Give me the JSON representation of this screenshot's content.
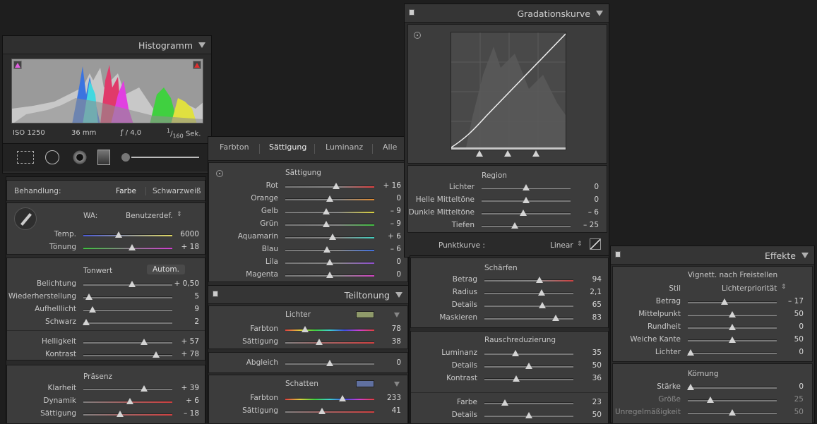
{
  "histogram": {
    "title": "Histogramm",
    "iso": "ISO 1250",
    "focal": "36 mm",
    "aperture": "ƒ / 4,0",
    "shutter_num": "1",
    "shutter_den": "160",
    "shutter_unit": "Sek."
  },
  "basic": {
    "treatment_label": "Behandlung:",
    "treatment_color": "Farbe",
    "treatment_bw": "Schwarzweiß",
    "wb_label": "WA:",
    "wb_value": "Benutzerdef.",
    "wb_sliders": [
      {
        "label": "Temp.",
        "value": "6000",
        "pos": 0.4,
        "grad": "linear-gradient(90deg,#4a5ad8,#e0d860)"
      },
      {
        "label": "Tönung",
        "value": "+ 18",
        "pos": 0.55,
        "grad": "linear-gradient(90deg,#40c040,#d040d0)"
      }
    ],
    "tone_title": "Tonwert",
    "auto_label": "Autom.",
    "tone_sliders": [
      {
        "label": "Belichtung",
        "value": "+ 0,50",
        "pos": 0.55
      },
      {
        "label": "Wiederherstellung",
        "value": "5",
        "pos": 0.06
      },
      {
        "label": "Aufhelllicht",
        "value": "9",
        "pos": 0.1
      },
      {
        "label": "Schwarz",
        "value": "2",
        "pos": 0.03
      }
    ],
    "tone2_sliders": [
      {
        "label": "Helligkeit",
        "value": "+ 57",
        "pos": 0.68
      },
      {
        "label": "Kontrast",
        "value": "+ 78",
        "pos": 0.82
      }
    ],
    "presence_title": "Präsenz",
    "presence_sliders": [
      {
        "label": "Klarheit",
        "value": "+ 39",
        "pos": 0.68,
        "grad": ""
      },
      {
        "label": "Dynamik",
        "value": "+ 6",
        "pos": 0.52,
        "grad": "linear-gradient(90deg,#808080,#d04040)"
      },
      {
        "label": "Sättigung",
        "value": "– 18",
        "pos": 0.41,
        "grad": "linear-gradient(90deg,#808080,#d04040)"
      }
    ]
  },
  "hsl": {
    "tabs": [
      "Farbton",
      "Sättigung",
      "Luminanz",
      "Alle"
    ],
    "section_title": "Sättigung",
    "sliders": [
      {
        "label": "Rot",
        "value": "+ 16",
        "pos": 0.57,
        "color": "#e04040"
      },
      {
        "label": "Orange",
        "value": "0",
        "pos": 0.5,
        "color": "#e08a30"
      },
      {
        "label": "Gelb",
        "value": "– 9",
        "pos": 0.46,
        "color": "#d8d040"
      },
      {
        "label": "Grün",
        "value": "– 9",
        "pos": 0.46,
        "color": "#40c040"
      },
      {
        "label": "Aquamarin",
        "value": "+ 6",
        "pos": 0.53,
        "color": "#40d0c0"
      },
      {
        "label": "Blau",
        "value": "– 6",
        "pos": 0.47,
        "color": "#4070e0"
      },
      {
        "label": "Lila",
        "value": "0",
        "pos": 0.5,
        "color": "#9050d0"
      },
      {
        "label": "Magenta",
        "value": "0",
        "pos": 0.5,
        "color": "#d040c0"
      }
    ]
  },
  "split": {
    "title": "Teiltonung",
    "highlights_title": "Lichter",
    "highlights_swatch": "#8f9a6a",
    "highlights_sliders": [
      {
        "label": "Farbton",
        "value": "78",
        "pos": 0.22,
        "grad": "linear-gradient(90deg,#e04040,#e0d040,#40d040,#40d0d0,#4050e0,#d040d0,#e04040)"
      },
      {
        "label": "Sättigung",
        "value": "38",
        "pos": 0.38,
        "grad": "linear-gradient(90deg,#808080,#d04040)"
      }
    ],
    "balance": {
      "label": "Abgleich",
      "value": "0",
      "pos": 0.5
    },
    "shadows_title": "Schatten",
    "shadows_swatch": "#6070a0",
    "shadows_sliders": [
      {
        "label": "Farbton",
        "value": "233",
        "pos": 0.64,
        "grad": "linear-gradient(90deg,#e04040,#e0d040,#40d040,#40d0d0,#4050e0,#d040d0,#e04040)"
      },
      {
        "label": "Sättigung",
        "value": "41",
        "pos": 0.41,
        "grad": "linear-gradient(90deg,#808080,#d04040)"
      }
    ]
  },
  "curve": {
    "title": "Gradationskurve",
    "region_title": "Region",
    "sliders": [
      {
        "label": "Lichter",
        "value": "0",
        "pos": 0.5
      },
      {
        "label": "Helle Mitteltöne",
        "value": "0",
        "pos": 0.5
      },
      {
        "label": "Dunkle Mitteltöne",
        "value": "– 6",
        "pos": 0.47
      },
      {
        "label": "Tiefen",
        "value": "– 25",
        "pos": 0.37
      }
    ],
    "point_curve_label": "Punktkurve :",
    "point_curve_value": "Linear"
  },
  "detail": {
    "sharpen_title": "Schärfen",
    "sharpen_sliders": [
      {
        "label": "Betrag",
        "value": "94",
        "pos": 0.62,
        "grad": ""
      },
      {
        "label": "Radius",
        "value": "2,1",
        "pos": 0.64,
        "grad": ""
      },
      {
        "label": "Details",
        "value": "65",
        "pos": 0.65,
        "grad": ""
      },
      {
        "label": "Maskieren",
        "value": "83",
        "pos": 0.8,
        "grad": ""
      }
    ],
    "nr_title": "Rauschreduzierung",
    "nr_sliders": [
      {
        "label": "Luminanz",
        "value": "35",
        "pos": 0.35
      },
      {
        "label": "Details",
        "value": "50",
        "pos": 0.5
      },
      {
        "label": "Kontrast",
        "value": "36",
        "pos": 0.36
      }
    ],
    "nr2_sliders": [
      {
        "label": "Farbe",
        "value": "23",
        "pos": 0.23
      },
      {
        "label": "Details",
        "value": "50",
        "pos": 0.5
      }
    ]
  },
  "effects": {
    "title": "Effekte",
    "vignette_title": "Vignett. nach Freistellen",
    "style_label": "Stil",
    "style_value": "Lichterpriorität",
    "vignette_sliders": [
      {
        "label": "Betrag",
        "value": "– 17",
        "pos": 0.41
      },
      {
        "label": "Mittelpunkt",
        "value": "50",
        "pos": 0.5
      },
      {
        "label": "Rundheit",
        "value": "0",
        "pos": 0.5
      },
      {
        "label": "Weiche Kante",
        "value": "50",
        "pos": 0.5
      },
      {
        "label": "Lichter",
        "value": "0",
        "pos": 0.03
      }
    ],
    "grain_title": "Körnung",
    "grain_sliders": [
      {
        "label": "Stärke",
        "value": "0",
        "pos": 0.03
      },
      {
        "label": "Größe",
        "value": "25",
        "pos": 0.25
      },
      {
        "label": "Unregelmäßigkeit",
        "value": "50",
        "pos": 0.5
      }
    ]
  }
}
